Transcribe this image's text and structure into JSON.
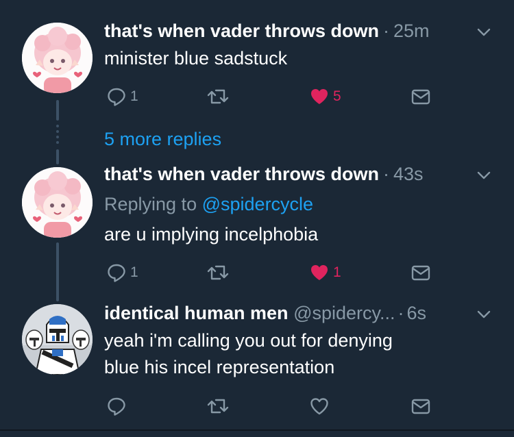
{
  "thread": {
    "more_replies": "5 more replies"
  },
  "tweets": [
    {
      "name": "that's when vader throws down",
      "handle": "",
      "separator": "·",
      "time": "25m",
      "replying_prefix": "",
      "replying_to": "",
      "text_lines": [
        "minister blue sadstuck"
      ],
      "reply_count": "1",
      "retweet_count": "",
      "like_count": "5",
      "liked": true,
      "avatar_icon": "pink-haired-anime-avatar"
    },
    {
      "name": "that's when vader throws down",
      "handle": "",
      "separator": "·",
      "time": "43s",
      "replying_prefix": "Replying to",
      "replying_to": "@spidercycle",
      "text_lines": [
        "are u implying incelphobia"
      ],
      "reply_count": "1",
      "retweet_count": "",
      "like_count": "1",
      "liked": true,
      "avatar_icon": "pink-haired-anime-avatar"
    },
    {
      "name": "identical human men",
      "handle": "@spidercy...",
      "separator": "·",
      "time": "6s",
      "replying_prefix": "",
      "replying_to": "",
      "text_lines": [
        "yeah i'm calling you out for denying",
        "blue his incel representation"
      ],
      "reply_count": "",
      "retweet_count": "",
      "like_count": "",
      "liked": false,
      "avatar_icon": "clone-trooper-avatar"
    }
  ],
  "colors": {
    "background": "#1b2836",
    "text": "#ffffff",
    "muted": "#8899a6",
    "link": "#1da1f2",
    "like": "#e0245e",
    "thread_line": "#3d5166"
  },
  "icons": {
    "reply": "reply-icon",
    "retweet": "retweet-icon",
    "like": "heart-icon",
    "dm": "envelope-icon",
    "caret": "chevron-down-icon"
  }
}
